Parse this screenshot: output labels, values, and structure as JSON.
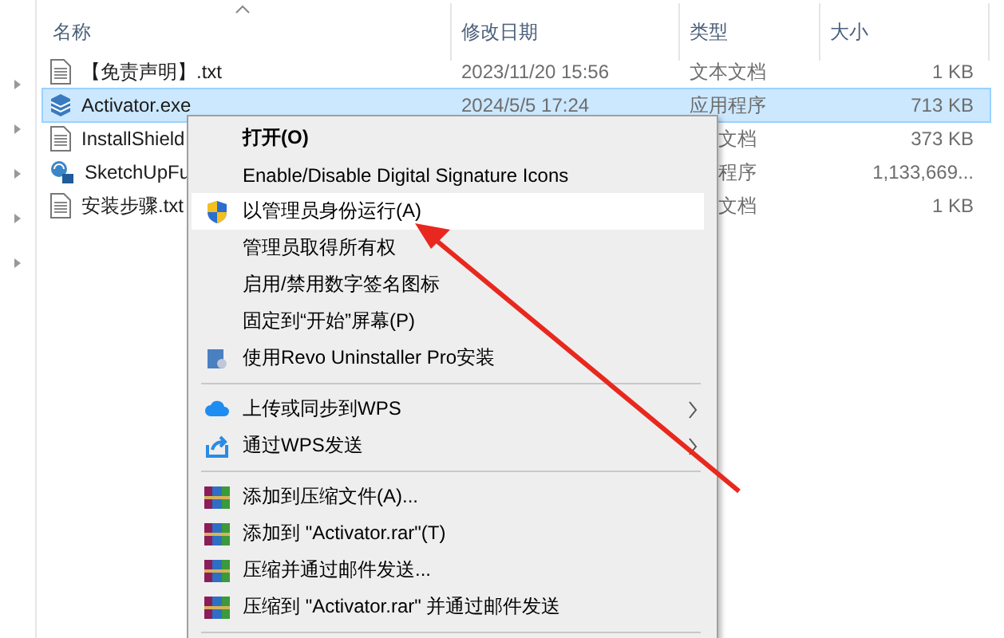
{
  "columns": [
    {
      "label": "名称"
    },
    {
      "label": "修改日期"
    },
    {
      "label": "类型"
    },
    {
      "label": "大小"
    }
  ],
  "files": [
    {
      "kind": "text",
      "name": "【免责声明】.txt",
      "date": "2023/11/20 15:56",
      "type": "文本文档",
      "size": "1 KB",
      "selected": false
    },
    {
      "kind": "exe",
      "name": "Activator.exe",
      "date": "2024/5/5 17:24",
      "type": "应用程序",
      "size": "713 KB",
      "selected": true
    },
    {
      "kind": "text",
      "name": "InstallShield",
      "type": "文档",
      "size": "373 KB",
      "selected": false
    },
    {
      "kind": "setup",
      "name": "SketchUpFu",
      "type": "程序",
      "size": "1,133,669...",
      "selected": false
    },
    {
      "kind": "text",
      "name": "安装步骤.txt",
      "type": "文档",
      "size": "1 KB",
      "selected": false
    }
  ],
  "menu": [
    {
      "kind": "plain",
      "label": "打开(O)",
      "default": true,
      "selected": false
    },
    {
      "kind": "plain",
      "label": "Enable/Disable Digital Signature Icons",
      "selected": false
    },
    {
      "kind": "shield",
      "label": "以管理员身份运行(A)",
      "selected": true
    },
    {
      "kind": "plain",
      "label": "管理员取得所有权",
      "selected": false
    },
    {
      "kind": "plain",
      "label": "启用/禁用数字签名图标",
      "selected": false
    },
    {
      "kind": "plain",
      "label": "固定到“开始”屏幕(P)",
      "selected": false
    },
    {
      "kind": "installer",
      "label": "使用Revo Uninstaller Pro安装",
      "selected": false
    },
    {
      "kind": "separator"
    },
    {
      "kind": "cloud",
      "label": "上传或同步到WPS",
      "submenu": true,
      "selected": false
    },
    {
      "kind": "share",
      "label": "通过WPS发送",
      "submenu": true,
      "selected": false
    },
    {
      "kind": "separator"
    },
    {
      "kind": "archive",
      "label": "添加到压缩文件(A)...",
      "selected": false
    },
    {
      "kind": "archive",
      "label": "添加到 \"Activator.rar\"(T)",
      "selected": false
    },
    {
      "kind": "archive",
      "label": "压缩并通过邮件发送...",
      "selected": false
    },
    {
      "kind": "archive",
      "label": "压缩到 \"Activator.rar\" 并通过邮件发送",
      "selected": false
    },
    {
      "kind": "separator"
    }
  ]
}
